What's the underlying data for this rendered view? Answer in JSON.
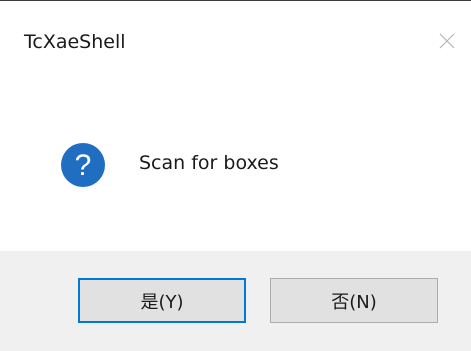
{
  "window": {
    "title": "TcXaeShell",
    "close_icon": "close-icon"
  },
  "message": {
    "icon": "question-icon",
    "icon_color": "#1f6ec2",
    "text": "Scan for boxes"
  },
  "buttons": {
    "yes_label": "是(Y)",
    "no_label": "否(N)",
    "default_border_color": "#0078d7"
  }
}
